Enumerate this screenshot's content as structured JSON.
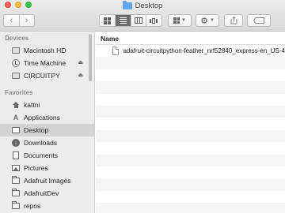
{
  "window": {
    "title": "Desktop"
  },
  "toolbar": {
    "back_icon": "‹",
    "forward_icon": "›"
  },
  "sidebar": {
    "devices_label": "Devices",
    "devices": [
      {
        "label": "Macintosh HD",
        "icon": "hard-disk-icon",
        "eject": false
      },
      {
        "label": "Time Machine",
        "icon": "time-machine-icon",
        "eject": true
      },
      {
        "label": "CIRCUITPY",
        "icon": "external-disk-icon",
        "eject": true
      }
    ],
    "favorites_label": "Favorites",
    "favorites": [
      {
        "label": "kattni",
        "icon": "home-icon"
      },
      {
        "label": "Applications",
        "icon": "applications-icon"
      },
      {
        "label": "Desktop",
        "icon": "desktop-icon",
        "selected": true
      },
      {
        "label": "Downloads",
        "icon": "downloads-icon"
      },
      {
        "label": "Documents",
        "icon": "documents-icon"
      },
      {
        "label": "Pictures",
        "icon": "pictures-icon"
      },
      {
        "label": "Adafruit Images",
        "icon": "folder-icon"
      },
      {
        "label": "AdafruitDev",
        "icon": "folder-icon"
      },
      {
        "label": "repos",
        "icon": "folder-icon"
      }
    ],
    "eject_symbol": "⏏"
  },
  "file_list": {
    "column_name": "Name",
    "files": [
      {
        "name": "adafruit-circuitpython-feather_nrf52840_express-en_US-4"
      }
    ]
  },
  "colors": {
    "folder_accent": "#5fa7ea",
    "selection": "#d3d3d3"
  }
}
